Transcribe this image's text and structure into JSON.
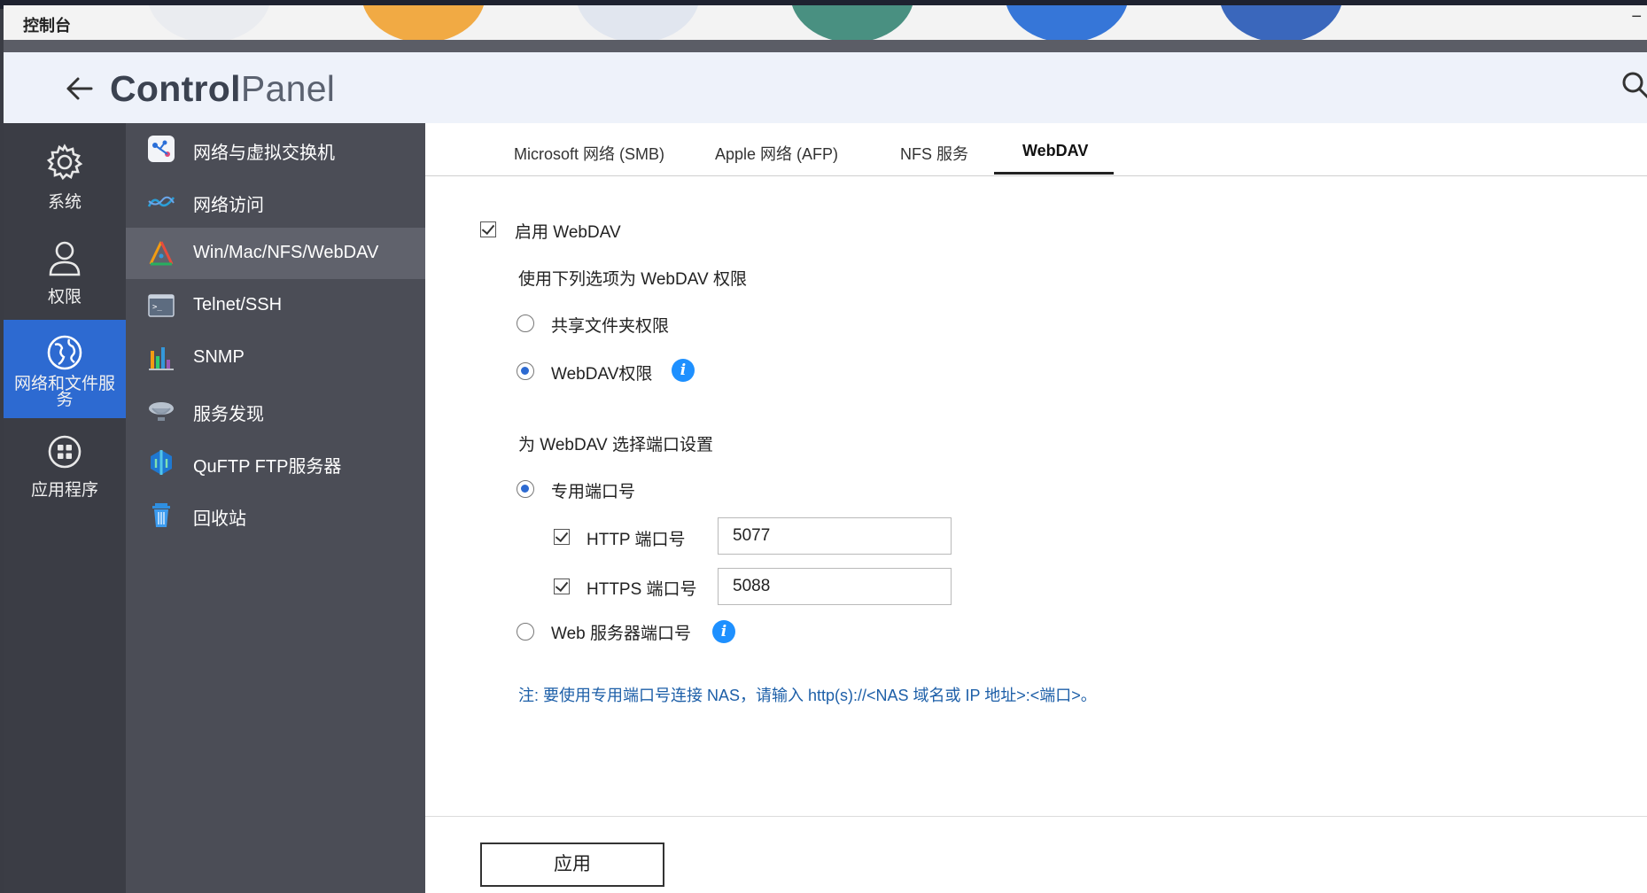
{
  "window": {
    "title": "控制台",
    "minimize_label": "−"
  },
  "header": {
    "brand_bold": "Control",
    "brand_light": "Panel"
  },
  "rail": {
    "items": [
      {
        "label": "系统",
        "icon": "gear-icon"
      },
      {
        "label": "权限",
        "icon": "user-icon"
      },
      {
        "label": "网络和文件服务",
        "icon": "globe-icon"
      },
      {
        "label": "应用程序",
        "icon": "apps-grid-icon"
      }
    ],
    "active_index": 2
  },
  "submenu": {
    "items": [
      {
        "label": "网络与虚拟交换机",
        "icon": "network-switch-icon"
      },
      {
        "label": "网络访问",
        "icon": "network-access-icon"
      },
      {
        "label": "Win/Mac/NFS/WebDAV",
        "icon": "file-protocol-icon"
      },
      {
        "label": "Telnet/SSH",
        "icon": "terminal-icon"
      },
      {
        "label": "SNMP",
        "icon": "bar-chart-icon"
      },
      {
        "label": "服务发现",
        "icon": "satellite-dish-icon"
      },
      {
        "label": "QuFTP FTP服务器",
        "icon": "ftp-server-icon"
      },
      {
        "label": "回收站",
        "icon": "recycle-bin-icon"
      }
    ],
    "active_index": 2
  },
  "tabs": [
    {
      "label": "Microsoft 网络 (SMB)"
    },
    {
      "label": "Apple 网络 (AFP)"
    },
    {
      "label": "NFS 服务"
    },
    {
      "label": "WebDAV"
    }
  ],
  "active_tab": "WebDAV",
  "webdav": {
    "enable_label": "启用 WebDAV",
    "enable_checked": true,
    "permission_heading": "使用下列选项为 WebDAV 权限",
    "opt_shared_folder": "共享文件夹权限",
    "opt_webdav_perm": "WebDAV权限",
    "permission_selected": "WebDAV权限",
    "port_heading": "为 WebDAV 选择端口设置",
    "opt_dedicated_port": "专用端口号",
    "port_selected": "专用端口号",
    "http_label": "HTTP 端口号",
    "http_checked": true,
    "http_value": "5077",
    "https_label": "HTTPS 端口号",
    "https_checked": true,
    "https_value": "5088",
    "opt_web_server_port": "Web 服务器端口号",
    "info_glyph": "i",
    "note": "注: 要使用专用端口号连接 NAS，请输入 http(s)://<NAS 域名或 IP 地址>:<端口>。"
  },
  "apply_label": "应用",
  "colors": {
    "accent": "#2d6ad1",
    "rail_bg": "#3b3d45",
    "submenu_bg": "#4b4d56",
    "note": "#1d5fa8",
    "info": "#1e90ff"
  }
}
